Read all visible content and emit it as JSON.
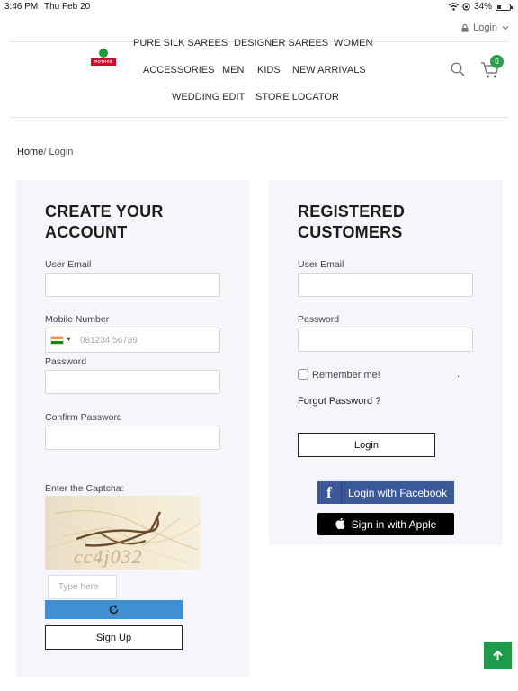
{
  "status_bar": {
    "time": "3:46 PM",
    "date": "Thu Feb 20",
    "battery": "34%",
    "battery_level": 0.34
  },
  "header": {
    "login_label": "Login",
    "logo_text": "POTHYS",
    "nav": {
      "pure_silk_sarees": "PURE SILK SAREES",
      "designer_sarees": "DESIGNER SAREES",
      "women": "WOMEN",
      "accessories": "ACCESSORIES",
      "men": "MEN",
      "kids": "KIDS",
      "new_arrivals": "NEW ARRIVALS",
      "wedding_edit": "WEDDING EDIT",
      "store_locator": "STORE LOCATOR"
    },
    "cart_count": "0"
  },
  "breadcrumb": {
    "home": "Home",
    "separator": "/",
    "current": "Login"
  },
  "create_account": {
    "heading_line1": "CREATE YOUR",
    "heading_line2": "ACCOUNT",
    "email_label": "User Email",
    "mobile_label": "Mobile Number",
    "mobile_placeholder": "081234 56789",
    "password_label": "Password",
    "confirm_password_label": "Confirm Password",
    "captcha_label": "Enter the Captcha:",
    "captcha_text": "cc4j032",
    "captcha_placeholder": "Type here",
    "signup_label": "Sign Up"
  },
  "registered": {
    "heading_line1": "REGISTERED",
    "heading_line2": "CUSTOMERS",
    "email_label": "User Email",
    "password_label": "Password",
    "remember_label": "Remember me!",
    "dot": ".",
    "forgot_label": "Forgot Password ?",
    "login_label": "Login",
    "facebook_label": "Login with Facebook",
    "apple_label": "Sign in with Apple"
  },
  "colors": {
    "facebook": "#3b5998",
    "apple": "#000000",
    "refresh": "#3f8fd2",
    "accent_green": "#1f9b4b",
    "panel_bg": "#f6f5f9"
  },
  "icons": {
    "wifi": "wifi-icon",
    "rotation_lock": "rotation-lock-icon",
    "lock": "lock-icon",
    "search": "search-icon",
    "cart": "cart-icon",
    "refresh": "refresh-icon",
    "facebook": "facebook-icon",
    "apple": "apple-icon",
    "arrow_up": "arrow-up-icon"
  }
}
